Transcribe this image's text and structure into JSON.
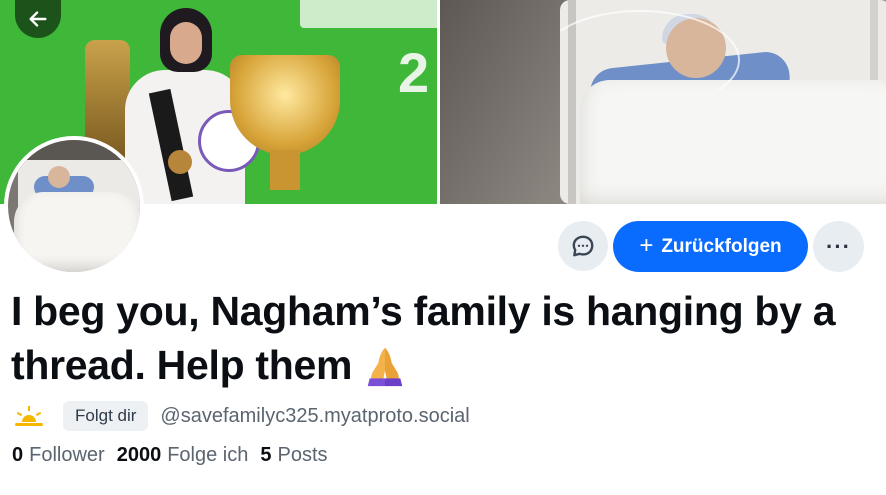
{
  "banner": {
    "left_image": "karate-athlete-with-trophies",
    "right_image": "patient-in-hospital-bed",
    "left_text_numeral": "2"
  },
  "nav": {
    "back_icon": "arrow-left-icon"
  },
  "avatar": {
    "image": "patient-in-hospital-bed"
  },
  "actions": {
    "message_icon": "chat-bubble-icon",
    "follow_label": "Zurückfolgen",
    "follow_icon": "plus-icon",
    "more_icon": "ellipsis-icon",
    "more_label": "···"
  },
  "profile": {
    "display_name": "I beg you, Nagham’s family is hanging by a thread. Help them",
    "name_emoji": "folded-hands-icon",
    "follows_you_label": "Folgt dir",
    "handle": "@savefamilyc325.myatproto.social"
  },
  "stats": {
    "followers_count": "0",
    "followers_label": "Follower",
    "following_count": "2000",
    "following_label": "Folge ich",
    "posts_count": "5",
    "posts_label": "Posts"
  },
  "colors": {
    "accent": "#0a6cff",
    "button_bg": "#e8edf2",
    "badge_bg": "#eef1f4",
    "banner_green": "#3fb83a"
  }
}
